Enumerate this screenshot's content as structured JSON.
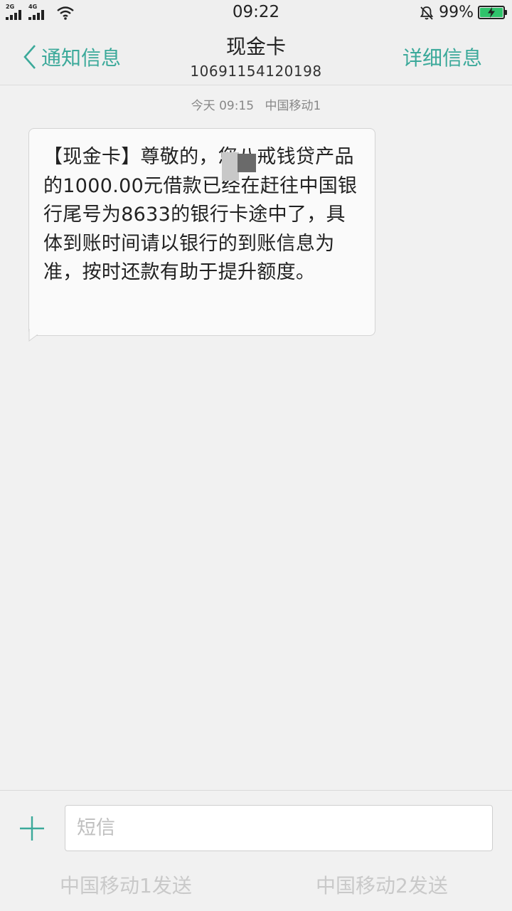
{
  "status_bar": {
    "sim1_label": "2G",
    "sim2_label": "4G",
    "time": "09:22",
    "battery_percent_text": "99%",
    "battery_level": 0.99,
    "icons": [
      "signal-icon",
      "wifi-icon",
      "mute-icon",
      "battery-icon"
    ]
  },
  "header": {
    "back_label": "通知信息",
    "title": "现金卡",
    "subtitle": "10691154120198",
    "details_label": "详细信息"
  },
  "message": {
    "time": "今天 09:15",
    "carrier": "中国移动1",
    "text": "【现金卡】尊敬的，您八戒钱贷产品的1000.00元借款已经在赶往中国银行尾号为8633的银行卡途中了，具体到账时间请以银行的到账信息为准，按时还款有助于提升额度。"
  },
  "composer": {
    "placeholder": "短信",
    "send1_label": "中国移动1发送",
    "send2_label": "中国移动2发送"
  },
  "colors": {
    "accent": "#3ba99a",
    "background": "#f1f1f1",
    "bubble": "#fafafa",
    "disabled_text": "#c9c9c9"
  }
}
